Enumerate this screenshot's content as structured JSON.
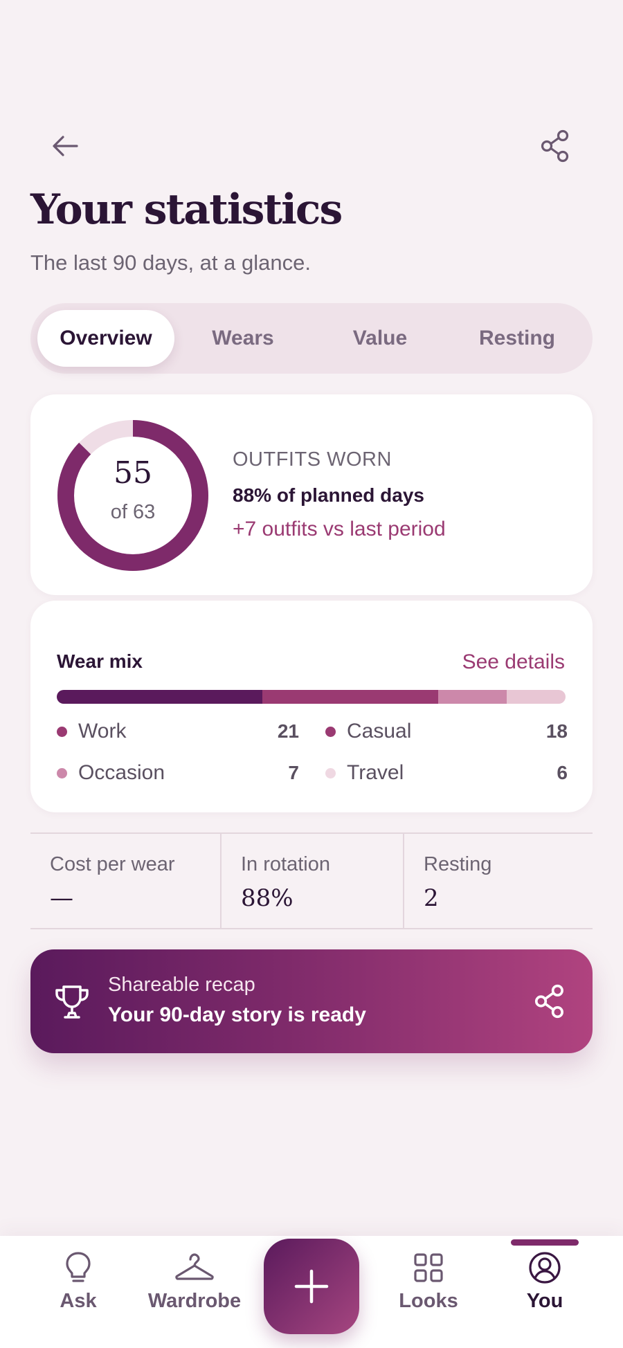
{
  "header": {
    "title": "Your statistics",
    "subtitle": "The last 90 days, at a glance."
  },
  "tabs": [
    {
      "label": "Overview",
      "active": true
    },
    {
      "label": "Wears",
      "active": false
    },
    {
      "label": "Value",
      "active": false
    },
    {
      "label": "Resting",
      "active": false
    }
  ],
  "outfits": {
    "worn": "55",
    "of_label": "of 63",
    "worn_value": 55,
    "planned_value": 63,
    "label": "OUTFITS WORN",
    "percent_text": "88% of planned days",
    "delta_text": "+7 outfits vs last period"
  },
  "wear_mix": {
    "title": "Wear mix",
    "link": "See details",
    "items": [
      {
        "name": "Work",
        "value": 21,
        "color": "#5a1a5c"
      },
      {
        "name": "Casual",
        "value": 18,
        "color": "#9a3a72"
      },
      {
        "name": "Occasion",
        "value": 7,
        "color": "#cc88aa"
      },
      {
        "name": "Travel",
        "value": 6,
        "color": "#e8c6d4"
      }
    ]
  },
  "stats": [
    {
      "label": "Cost per wear",
      "value": "—"
    },
    {
      "label": "In rotation",
      "value": "88%"
    },
    {
      "label": "Resting",
      "value": "2"
    }
  ],
  "recap": {
    "label": "Shareable recap",
    "main": "Your 90-day story is ready"
  },
  "nav": [
    {
      "label": "Ask",
      "icon": "lightbulb-icon",
      "active": false
    },
    {
      "label": "Wardrobe",
      "icon": "hanger-icon",
      "active": false
    },
    {
      "label": "Looks",
      "icon": "grid-icon",
      "active": false
    },
    {
      "label": "You",
      "icon": "user-circle-icon",
      "active": true
    }
  ],
  "colors": {
    "accent": "#7e2a6a",
    "accent_text": "#9a3a72",
    "ring_track": "#efdde6",
    "ink": "#2b1535",
    "background": "#f7f1f4"
  }
}
